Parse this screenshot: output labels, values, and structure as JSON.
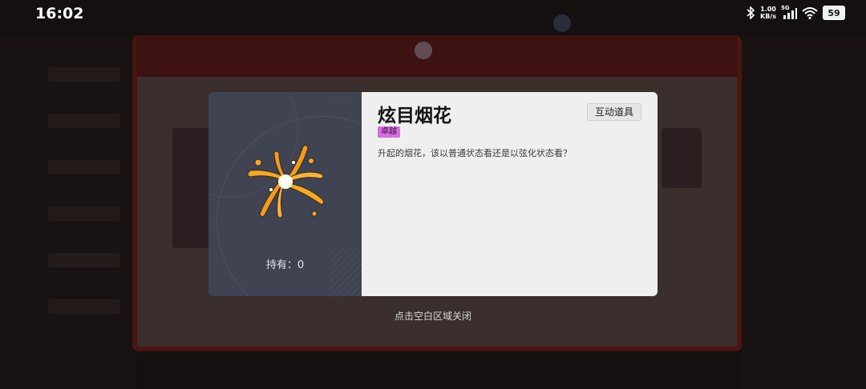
{
  "status_bar": {
    "time": "16:02",
    "network_speed_value": "1.00",
    "network_speed_unit": "KB/s",
    "signal_label": "5G",
    "battery": "59"
  },
  "item_modal": {
    "name": "炫目烟花",
    "rarity": "卓越",
    "rarity_color": "#d66de0",
    "category": "互动道具",
    "description": "升起的烟花，该以普通状态看还是以弦化状态看？",
    "owned_label": "持有：0",
    "icon": "firework-icon"
  },
  "close_hint": "点击空白区域关闭"
}
